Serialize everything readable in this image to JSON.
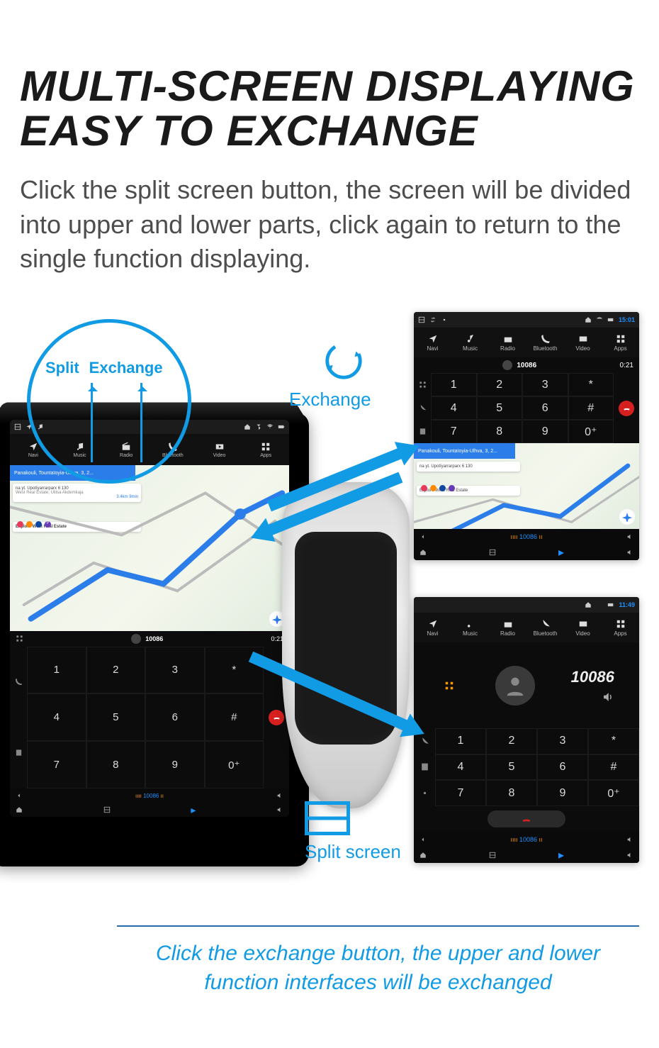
{
  "header": {
    "title_line1": "MULTI-SCREEN DISPLAYING",
    "title_line2": "EASY TO EXCHANGE",
    "description": "Click the split screen button, the screen will be divided into upper and lower parts, click again to return to the single function displaying."
  },
  "callouts": {
    "split_label": "Split",
    "exch_label_small": "Exchange",
    "exchange_label": "Exchange",
    "splitscreen_label": "Split screen"
  },
  "footer": {
    "text": "Click the exchange button, the upper and lower function interfaces will be exchanged"
  },
  "nav": {
    "items": [
      {
        "label": "Navi"
      },
      {
        "label": "Music"
      },
      {
        "label": "Radio"
      },
      {
        "label": "Bluetooth"
      },
      {
        "label": "Video"
      },
      {
        "label": "Apps"
      }
    ]
  },
  "map": {
    "blue_bar": "Panakouli, Tountaïoyia-Ulhva, 3, 2...",
    "card1_line1": "na yt. Upotïyarrarparx 6 130",
    "card1_line2": "West Real Estate, Ulitsa Akdemkaja",
    "card1_right": "3.4km  9min",
    "card2_title": "Explore West Real Estate",
    "dots": [
      "#e83a5b",
      "#ff8a00",
      "#0d47a1",
      "#673ab7"
    ]
  },
  "dialer": {
    "number": "10086",
    "time": "0:21",
    "keys": [
      "1",
      "2",
      "3",
      "*",
      "4",
      "5",
      "6",
      "#",
      "7",
      "8",
      "9",
      "0⁺"
    ]
  },
  "bottombar": {
    "now_playing": "10086"
  },
  "mini1": {
    "status_time": "15:01",
    "dial_number": "10086",
    "dial_time": "0:21",
    "now_playing": "10086"
  },
  "mini2": {
    "status_time": "11:49",
    "big_number": "10086",
    "now_playing": "10086"
  }
}
